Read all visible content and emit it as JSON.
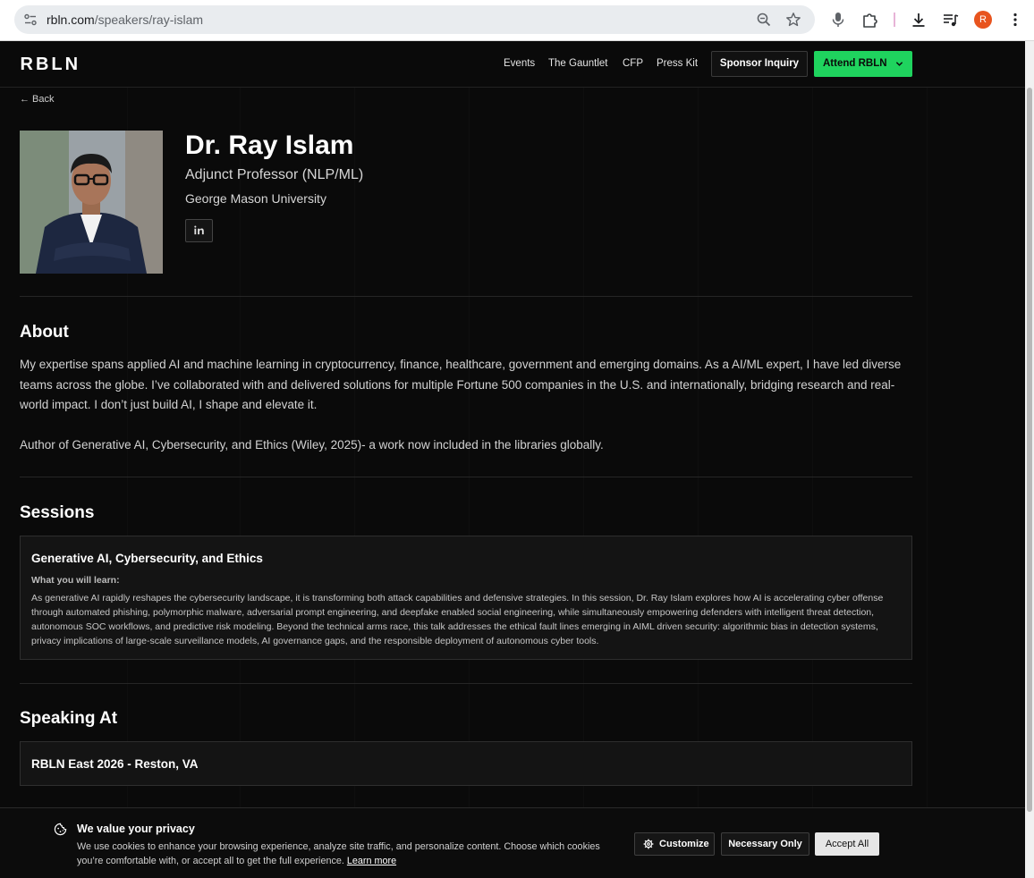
{
  "browser": {
    "url_domain": "rbln.com",
    "url_path": "/speakers/ray-islam",
    "profile_initial": "R"
  },
  "nav": {
    "logo_text": "RBLN",
    "links": [
      "Events",
      "The Gauntlet",
      "CFP",
      "Press Kit"
    ],
    "sponsor_label": "Sponsor Inquiry",
    "attend_label": "Attend RBLN"
  },
  "back_label": "← Back",
  "speaker": {
    "name": "Dr. Ray Islam",
    "title": "Adjunct Professor (NLP/ML)",
    "organization": "George Mason University"
  },
  "about": {
    "heading": "About",
    "paragraph_1": "My expertise spans applied AI and machine learning in cryptocurrency, finance, healthcare, government and emerging domains. As a AI/ML expert, I have led diverse teams across the globe. I’ve collaborated with and delivered solutions for multiple Fortune 500 companies in the U.S. and internationally, bridging research and real-world impact. I don’t just build AI, I shape and elevate it.",
    "paragraph_2": "Author of Generative AI, Cybersecurity, and Ethics (Wiley, 2025)- a work now included in the libraries globally."
  },
  "sessions": {
    "heading": "Sessions",
    "items": [
      {
        "title": "Generative AI, Cybersecurity, and Ethics",
        "learn_label": "What you will learn:",
        "description": "As generative AI rapidly reshapes the cybersecurity landscape, it is transforming both attack capabilities and defensive strategies. In this session, Dr. Ray Islam explores how AI is accelerating cyber offense through automated phishing, polymorphic malware, adversarial prompt engineering, and deepfake enabled social engineering, while simultaneously empowering defenders with intelligent threat detection, autonomous SOC workflows, and predictive risk modeling. Beyond the technical arms race, this talk addresses the ethical fault lines emerging in AIML driven security: algorithmic bias in detection systems, privacy implications of large-scale surveillance models, AI governance gaps, and the responsible deployment of autonomous cyber tools."
      }
    ]
  },
  "speaking_at": {
    "heading": "Speaking At",
    "events": [
      "RBLN East 2026 - Reston, VA"
    ]
  },
  "cookie": {
    "title": "We value your privacy",
    "text": "We use cookies to enhance your browsing experience, analyze site traffic, and personalize content. Choose which cookies you’re comfortable with, or accept all to get the full experience.",
    "learn_more": "Learn more",
    "customize_label": "Customize",
    "necessary_label": "Necessary Only",
    "accept_label": "Accept All"
  },
  "colors": {
    "accent_green": "#1fd35e",
    "background": "#0a0a0a",
    "avatar_orange": "#e8541e"
  },
  "icons": [
    "site-settings-icon",
    "zoom-icon",
    "bookmark-star-icon",
    "microphone-icon",
    "extensions-icon",
    "download-icon",
    "media-controls-icon",
    "menu-dots-icon",
    "chevron-down-icon",
    "linkedin-icon",
    "cookie-icon",
    "gear-icon"
  ]
}
